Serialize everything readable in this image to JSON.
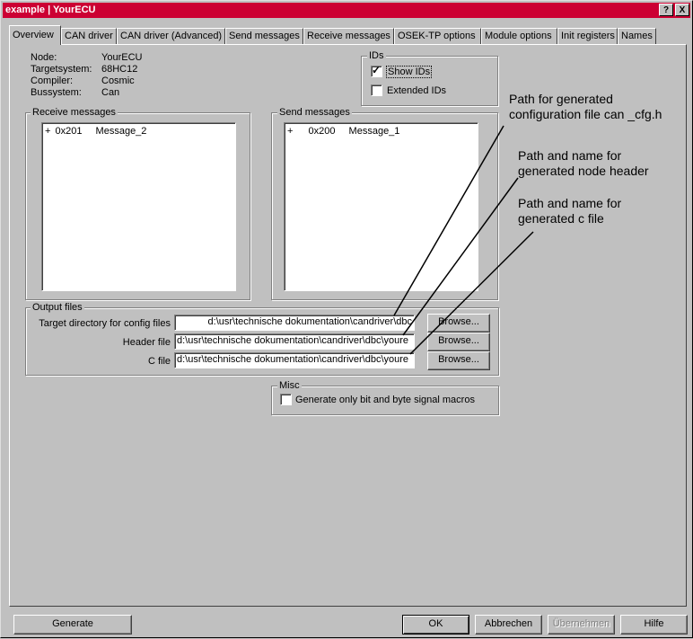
{
  "window": {
    "title": "example | YourECU",
    "help_glyph": "?",
    "close_glyph": "X"
  },
  "tabs": [
    "Overview",
    "CAN driver",
    "CAN driver (Advanced)",
    "Send messages",
    "Receive messages",
    "OSEK-TP options",
    "Module options",
    "Init registers",
    "Names"
  ],
  "node_info": [
    {
      "key": "Node:",
      "value": "YourECU"
    },
    {
      "key": "Targetsystem:",
      "value": "68HC12"
    },
    {
      "key": "Compiler:",
      "value": "Cosmic"
    },
    {
      "key": "Bussystem:",
      "value": "Can"
    }
  ],
  "ids": {
    "label": "IDs",
    "show_ids": "Show IDs",
    "show_ids_checked": true,
    "extended_ids": "Extended IDs",
    "extended_ids_checked": false
  },
  "receive": {
    "label": "Receive messages",
    "items": [
      {
        "prefix": "+",
        "id": "0x201",
        "name": "Message_2"
      }
    ]
  },
  "send": {
    "label": "Send messages",
    "items": [
      {
        "prefix": "+",
        "id": "0x200",
        "name": "Message_1"
      }
    ]
  },
  "output": {
    "label": "Output files",
    "target_label": "Target directory for config files",
    "target_value": "d:\\usr\\technische dokumentation\\candriver\\dbc",
    "header_label": "Header file",
    "header_value": "d:\\usr\\technische dokumentation\\candriver\\dbc\\youre",
    "c_label": "C file",
    "c_value": "d:\\usr\\technische dokumentation\\candriver\\dbc\\youre",
    "browse": "Browse..."
  },
  "misc": {
    "label": "Misc",
    "gen_only": "Generate only bit and byte signal macros",
    "gen_only_checked": false
  },
  "annotations": {
    "a1": [
      "Path for generated",
      "configuration file can _cfg.h"
    ],
    "a2": [
      "Path and name for",
      "generated node header"
    ],
    "a3": [
      "Path and name for",
      "generated c file"
    ]
  },
  "footer": {
    "generate": "Generate",
    "ok": "OK",
    "cancel": "Abbrechen",
    "apply": "Übernehmen",
    "help": "Hilfe"
  }
}
